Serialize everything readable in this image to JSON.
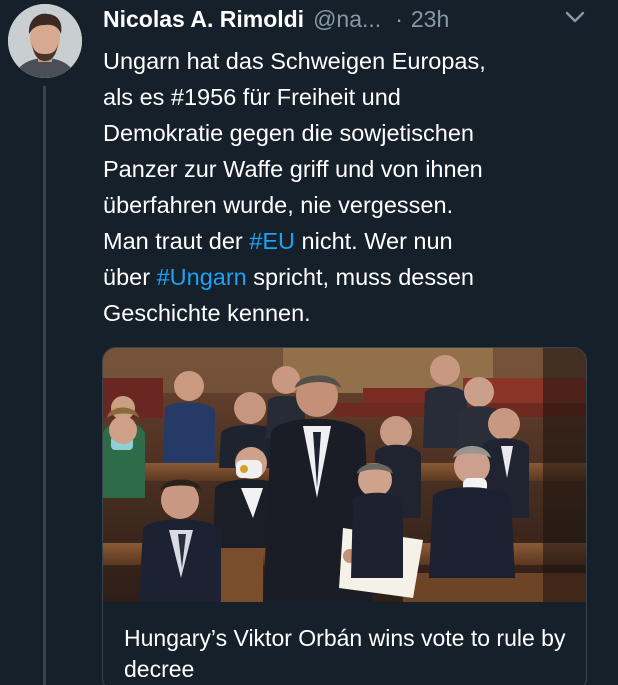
{
  "tweet": {
    "author_name": "Nicolas A. Rimoldi",
    "author_handle": "@na...",
    "separator": "·",
    "timestamp": "23h",
    "text_lines": [
      [
        "Ungarn hat das Schweigen Europas,"
      ],
      [
        "als es #1956 für Freiheit und"
      ],
      [
        "Demokratie gegen die sowjetischen"
      ],
      [
        "Panzer zur Waffe griff und von ihnen"
      ],
      [
        "überfahren wurde, nie vergessen."
      ],
      [
        "Man traut der ",
        "#EU",
        " nicht. Wer nun"
      ],
      [
        "über ",
        "#Ungarn",
        " spricht, muss dessen"
      ],
      [
        "Geschichte kennen."
      ]
    ],
    "hashtags": [
      "#EU",
      "#Ungarn"
    ]
  },
  "card": {
    "title": "Hungary’s Viktor Orbán wins vote to rule by decree"
  },
  "icons": {
    "menu": "chevron-down-icon",
    "avatar": "avatar"
  },
  "colors": {
    "background": "#15202b",
    "link": "#1da1f2",
    "muted": "#8899a6",
    "border": "#38444d"
  }
}
